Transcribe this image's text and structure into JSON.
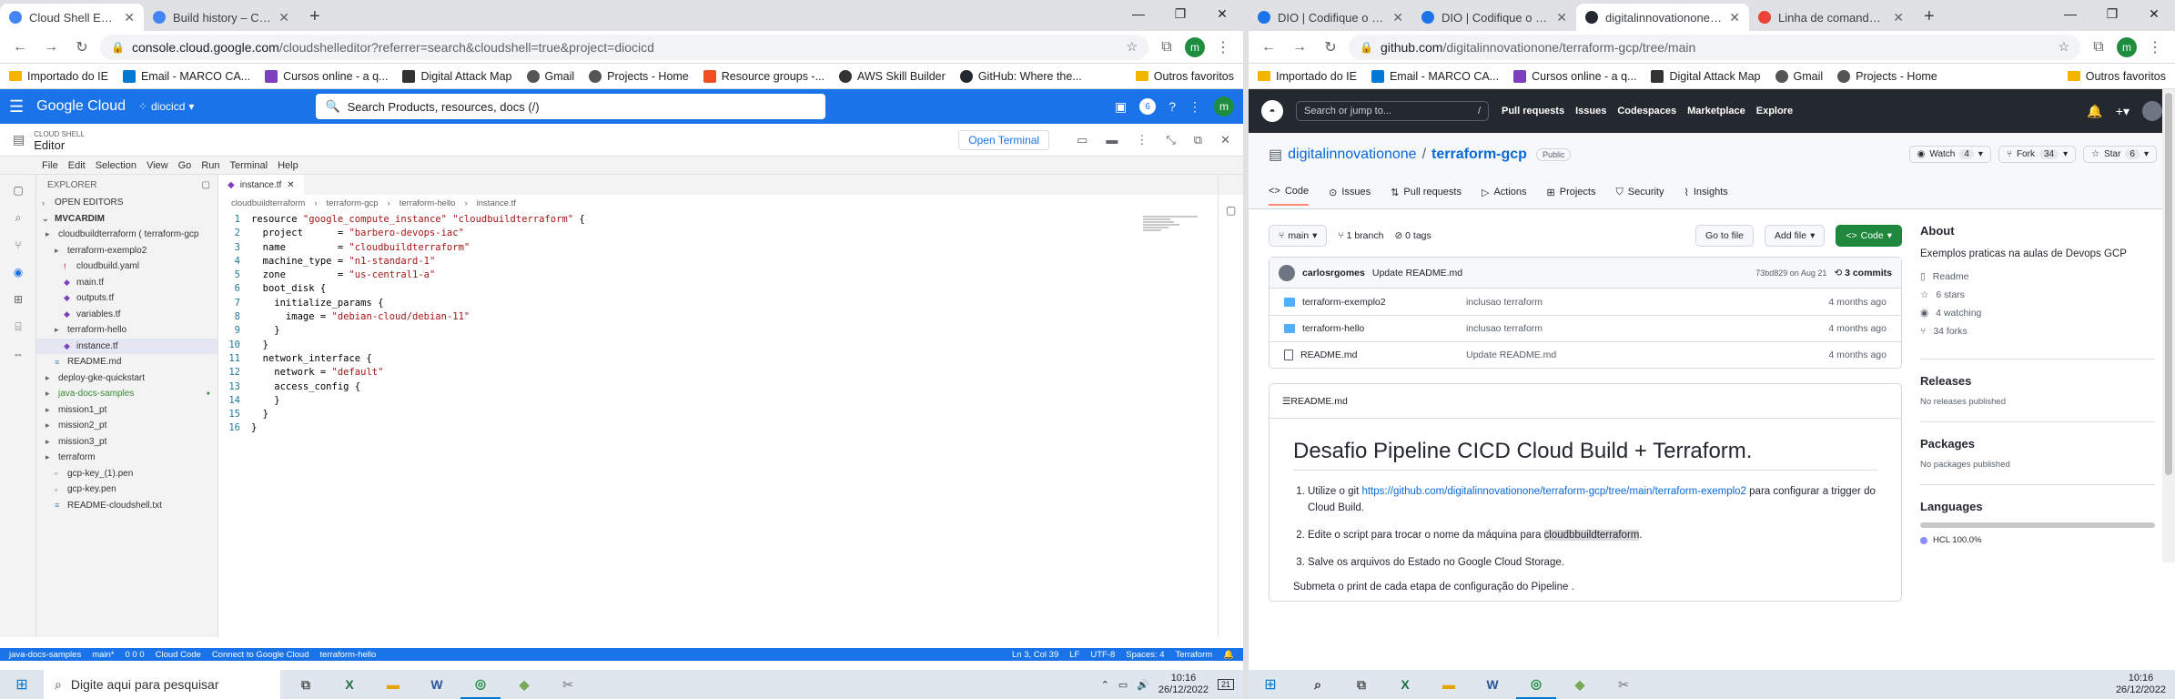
{
  "left_browser": {
    "tabs": [
      {
        "title": "Cloud Shell Editor – Cloud Shell I",
        "active": true
      },
      {
        "title": "Build history – Cloud Build – dioc",
        "active": false
      }
    ],
    "url_main": "console.cloud.google.com",
    "url_rest": "/cloudshelleditor?referrer=search&cloudshell=true&project=diocicd",
    "avatar": "m",
    "bookmarks": [
      "Importado do IE",
      "Email - MARCO CA...",
      "Cursos online - a q...",
      "Digital Attack Map",
      "Gmail",
      "Projects - Home",
      "Resource groups -...",
      "AWS Skill Builder",
      "GitHub: Where the...",
      "Outros favoritos"
    ]
  },
  "gcp": {
    "logo": "Google Cloud",
    "project": "diocicd",
    "search": "Search  Products, resources, docs (/)",
    "notif_count": "6",
    "cloudshell_small": "CLOUD SHELL",
    "cloudshell_big": "Editor",
    "open_terminal": "Open Terminal"
  },
  "ide": {
    "menu": [
      "File",
      "Edit",
      "Selection",
      "View",
      "Go",
      "Run",
      "Terminal",
      "Help"
    ],
    "explorer_title": "EXPLORER",
    "open_editors": "OPEN EDITORS",
    "workspace": "MVCARDIM",
    "tree": [
      {
        "label": "cloudbuildterraform ( terraform-gcp",
        "indent": 0,
        "icon": "folder"
      },
      {
        "label": "terraform-exemplo2",
        "indent": 1,
        "icon": "folder"
      },
      {
        "label": "cloudbuild.yaml",
        "indent": 2,
        "icon": "yaml"
      },
      {
        "label": "main.tf",
        "indent": 2,
        "icon": "tf"
      },
      {
        "label": "outputs.tf",
        "indent": 2,
        "icon": "tf"
      },
      {
        "label": "variables.tf",
        "indent": 2,
        "icon": "tf"
      },
      {
        "label": "terraform-hello",
        "indent": 1,
        "icon": "folder"
      },
      {
        "label": "instance.tf",
        "indent": 2,
        "icon": "tf",
        "selected": true
      },
      {
        "label": "README.md",
        "indent": 1,
        "icon": "md"
      },
      {
        "label": "deploy-gke-quickstart",
        "indent": 0,
        "icon": "folder"
      },
      {
        "label": "java-docs-samples",
        "indent": 0,
        "icon": "folder",
        "green": true
      },
      {
        "label": "mission1_pt",
        "indent": 0,
        "icon": "folder"
      },
      {
        "label": "mission2_pt",
        "indent": 0,
        "icon": "folder"
      },
      {
        "label": "mission3_pt",
        "indent": 0,
        "icon": "folder"
      },
      {
        "label": "terraform",
        "indent": 0,
        "icon": "folder"
      },
      {
        "label": "gcp-key_(1).pen",
        "indent": 1,
        "icon": "file"
      },
      {
        "label": "gcp-key.pen",
        "indent": 1,
        "icon": "file"
      },
      {
        "label": "README-cloudshell.txt",
        "indent": 1,
        "icon": "md"
      }
    ],
    "tab": "instance.tf",
    "crumbs": [
      "cloudbuildterraform",
      "terraform-gcp",
      "terraform-hello",
      "instance.tf"
    ],
    "code": [
      "resource \"google_compute_instance\" \"cloudbuildterraform\" {",
      "  project      = \"barbero-devops-iac\"",
      "  name         = \"cloudbuildterraform\"",
      "  machine_type = \"n1-standard-1\"",
      "  zone         = \"us-central1-a\"",
      "  boot_disk {",
      "    initialize_params {",
      "      image = \"debian-cloud/debian-11\"",
      "    }",
      "  }",
      "  network_interface {",
      "    network = \"default\"",
      "    access_config {",
      "    }",
      "  }",
      "}"
    ],
    "status_left": [
      "java-docs-samples",
      "main*",
      "0 0 0",
      "Cloud Code",
      "Connect to Google Cloud",
      "terraform-hello"
    ],
    "status_right": [
      "Ln 3, Col 39",
      "LF",
      "UTF-8",
      "Spaces: 4",
      "Terraform"
    ]
  },
  "right_browser": {
    "tabs": [
      {
        "title": "DIO | Codifique o seu f",
        "active": false
      },
      {
        "title": "DIO | Codifique o seu f",
        "active": false
      },
      {
        "title": "digitalinnovationone/te",
        "active": true
      },
      {
        "title": "Linha de comando gcl",
        "active": false
      }
    ],
    "url_main": "github.com",
    "url_rest": "/digitalinnovationone/terraform-gcp/tree/main",
    "bookmarks": [
      "Importado do IE",
      "Email - MARCO CA...",
      "Cursos online - a q...",
      "Digital Attack Map",
      "Gmail",
      "Projects - Home",
      "Outros favoritos"
    ]
  },
  "github": {
    "search": "Search or jump to...",
    "nav": [
      "Pull requests",
      "Issues",
      "Codespaces",
      "Marketplace",
      "Explore"
    ],
    "owner": "digitalinnovationone",
    "repo": "terraform-gcp",
    "visibility": "Public",
    "watch": "Watch",
    "watch_count": "4",
    "fork": "Fork",
    "fork_count": "34",
    "star": "Star",
    "star_count": "6",
    "tabs": [
      "Code",
      "Issues",
      "Pull requests",
      "Actions",
      "Projects",
      "Security",
      "Insights"
    ],
    "branch": "main",
    "branches": "1 branch",
    "tags": "0 tags",
    "goto_file": "Go to file",
    "add_file": "Add file",
    "code_btn": "Code",
    "commit_author": "carlosrgomes",
    "commit_msg": "Update README.md",
    "commit_meta": "73bd829 on Aug 21",
    "commits": "3 commits",
    "files": [
      {
        "name": "terraform-exemplo2",
        "msg": "inclusao terraform",
        "date": "4 months ago",
        "dir": true
      },
      {
        "name": "terraform-hello",
        "msg": "inclusao terraform",
        "date": "4 months ago",
        "dir": true
      },
      {
        "name": "README.md",
        "msg": "Update README.md",
        "date": "4 months ago",
        "dir": false
      }
    ],
    "readme_label": "README.md",
    "readme_title": "Desafio Pipeline CICD Cloud Build + Terraform.",
    "readme_li1_pre": "Utilize o git ",
    "readme_li1_link": "https://github.com/digitalinnovationone/terraform-gcp/tree/main/terraform-exemplo2",
    "readme_li1_post": " para configurar a trigger do Cloud Build.",
    "readme_li2_pre": "Edite o script para trocar o nome da máquina para ",
    "readme_li2_hl": "cloudbbuildterraform",
    "readme_li2_post": ".",
    "readme_li3": "Salve os arquivos do Estado no Google Cloud Storage.",
    "readme_p": "Submeta o print de cada etapa de configuração do Pipeline .",
    "about_title": "About",
    "about_desc": "Exemplos praticas na aulas de Devops GCP",
    "about_items": [
      "Readme",
      "6 stars",
      "4 watching",
      "34 forks"
    ],
    "releases_title": "Releases",
    "releases_text": "No releases published",
    "packages_title": "Packages",
    "packages_text": "No packages published",
    "languages_title": "Languages",
    "language": "HCL 100.0%"
  },
  "taskbar": {
    "search": "Digite aqui para pesquisar",
    "time": "10:16",
    "date": "26/12/2022",
    "notif": "21"
  }
}
